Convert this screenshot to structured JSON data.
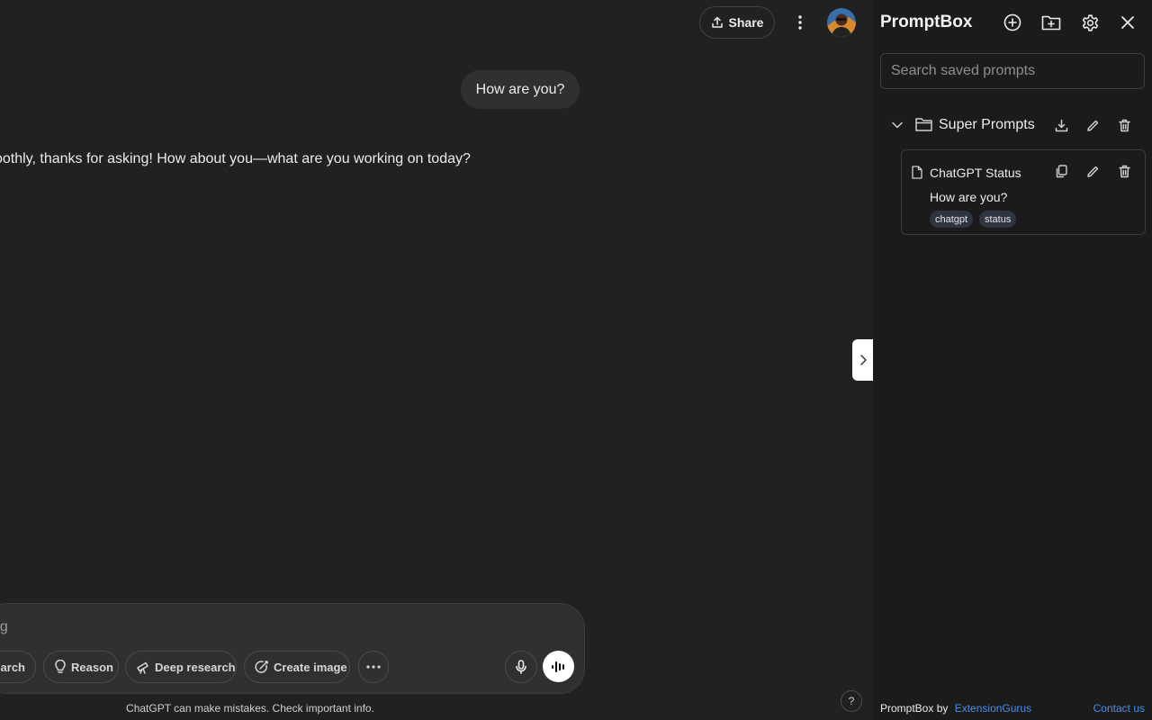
{
  "chat": {
    "share_label": "Share",
    "user_message": "How are you?",
    "assistant_message": "oothly, thanks for asking! How about you—what are you working on today?",
    "composer_placeholder": "ng",
    "tools": {
      "search": "earch",
      "reason": "Reason",
      "deep_research": "Deep research",
      "create_image": "Create image"
    },
    "disclaimer": "ChatGPT can make mistakes. Check important info.",
    "help": "?"
  },
  "panel": {
    "title": "PromptBox",
    "search_placeholder": "Search saved prompts",
    "folder": {
      "name": "Super Prompts",
      "prompts": [
        {
          "title": "ChatGPT Status",
          "text": "How are you?",
          "tags": [
            "chatgpt",
            "status"
          ]
        }
      ]
    },
    "footer": {
      "brand": "PromptBox by",
      "author": "ExtensionGurus",
      "contact": "Contact us"
    }
  },
  "colors": {
    "chat_bg": "#212121",
    "panel_bg": "#1b1b1b",
    "link": "#4b8de8",
    "tag_bg": "#2e3440"
  },
  "icons": [
    "share-icon",
    "more-vertical-icon",
    "user-avatar",
    "globe-icon",
    "lightbulb-icon",
    "telescope-icon",
    "image-edit-icon",
    "ellipsis-icon",
    "microphone-icon",
    "voice-waveform-icon",
    "chevron-right-icon",
    "plus-circle-icon",
    "folder-plus-icon",
    "gear-icon",
    "close-icon",
    "chevron-down-icon",
    "folder-icon",
    "download-icon",
    "pencil-icon",
    "trash-icon",
    "document-icon",
    "copy-icon"
  ]
}
